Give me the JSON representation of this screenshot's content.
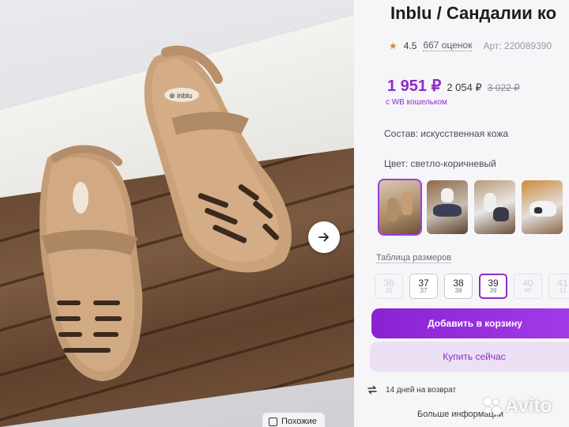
{
  "product": {
    "title": "Inblu / Сандалии ко",
    "rating": "4.5",
    "reviews": "667 оценок",
    "article": "Арт: 220089390",
    "price_main": "1 951 ₽",
    "price_second": "2 054 ₽",
    "price_old": "3 022 ₽",
    "wallet_note": "с WB кошельком",
    "composition": "Состав: искусственная кожа",
    "color": "Цвет: светло-коричневый"
  },
  "gallery": {
    "next_icon": "arrow-right-icon",
    "similar_label": "Похожие"
  },
  "sizes": {
    "table_label": "Таблица размеров",
    "items": [
      {
        "size": "36",
        "sub": "36",
        "state": "disabled"
      },
      {
        "size": "37",
        "sub": "37",
        "state": "available"
      },
      {
        "size": "38",
        "sub": "38",
        "state": "available"
      },
      {
        "size": "39",
        "sub": "39",
        "state": "selected"
      },
      {
        "size": "40",
        "sub": "40",
        "state": "disabled"
      },
      {
        "size": "41",
        "sub": "41",
        "state": "disabled"
      }
    ]
  },
  "actions": {
    "add_to_cart": "Добавить в корзину",
    "buy_now": "Купить сейчас"
  },
  "info": {
    "return_policy": "14 дней на возврат",
    "more_info": "Больше информации"
  },
  "watermark": "Avito",
  "colors": {
    "accent": "#8d2cc9",
    "accent_light": "#ece0f5",
    "star": "#e08a1e"
  }
}
